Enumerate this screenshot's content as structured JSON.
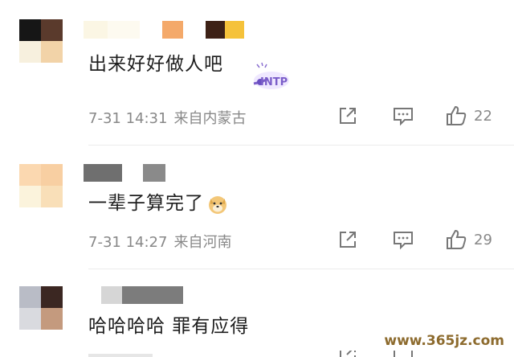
{
  "comments": [
    {
      "text": "出来好好做人吧",
      "time": "7-31 14:31",
      "location": "来自内蒙古",
      "likes": "22",
      "badge": "INTP"
    },
    {
      "text": "一辈子算完了",
      "time": "7-31 14:27",
      "location": "来自河南",
      "likes": "29",
      "emoji": "dog-face"
    },
    {
      "text": "哈哈哈哈 罪有应得"
    }
  ],
  "icons": {
    "share": "share-icon",
    "comment": "comment-icon",
    "like": "thumbs-up-icon"
  },
  "watermark": "www.365jz.com"
}
